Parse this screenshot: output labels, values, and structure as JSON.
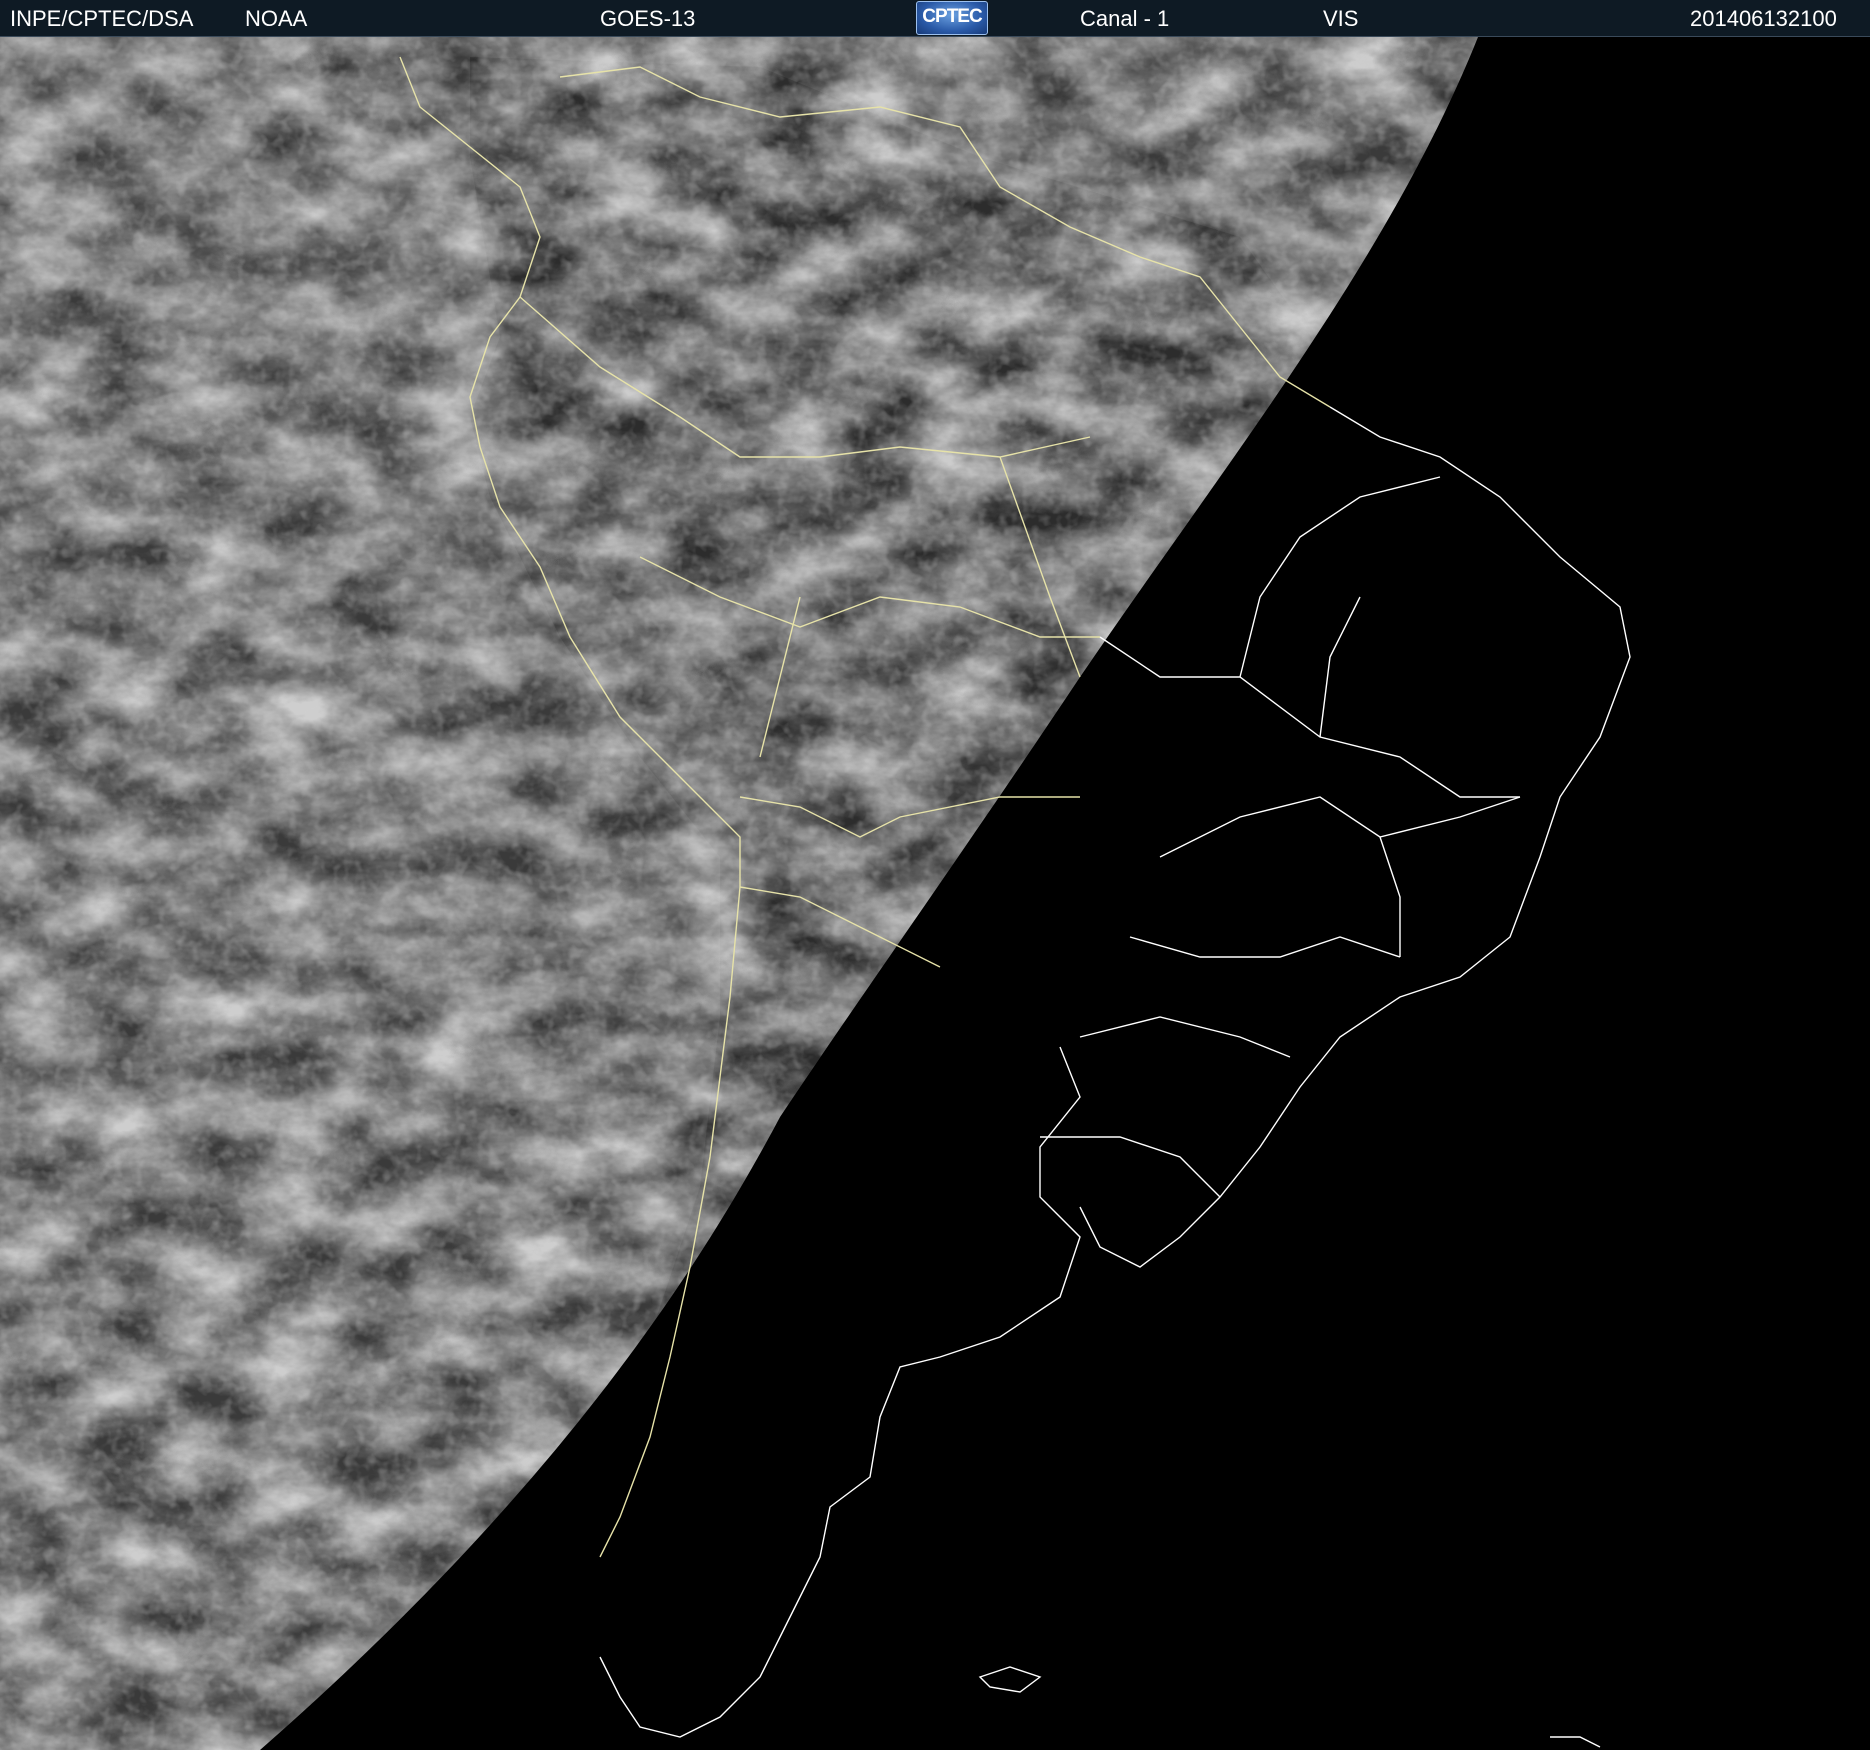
{
  "header": {
    "agency": "INPE/CPTEC/DSA",
    "provider": "NOAA",
    "satellite": "GOES-13",
    "logo_text": "CPTEC",
    "channel": "Canal - 1",
    "band": "VIS",
    "timestamp": "201406132100"
  },
  "colors": {
    "header_bg": "#0e1a24",
    "header_text": "#ffffff",
    "night_side": "#000000",
    "coastline": "#e6e2a8",
    "border_night": "#ffffff"
  },
  "image": {
    "description_icon": "satellite-visible-image",
    "terminator": "day-night"
  }
}
